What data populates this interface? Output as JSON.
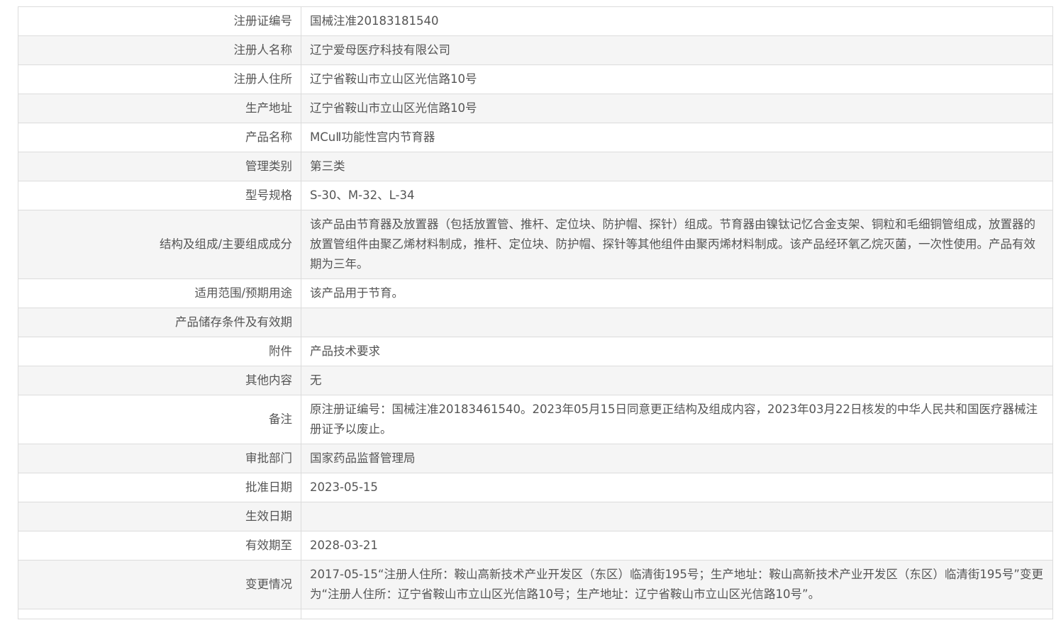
{
  "rows": [
    {
      "label": "注册证编号",
      "value": "国械注准20183181540"
    },
    {
      "label": "注册人名称",
      "value": "辽宁爱母医疗科技有限公司"
    },
    {
      "label": "注册人住所",
      "value": "辽宁省鞍山市立山区光信路10号"
    },
    {
      "label": "生产地址",
      "value": "辽宁省鞍山市立山区光信路10号"
    },
    {
      "label": "产品名称",
      "value": "MCuⅡ功能性宫内节育器"
    },
    {
      "label": "管理类别",
      "value": "第三类"
    },
    {
      "label": "型号规格",
      "value": "S-30、M-32、L-34"
    },
    {
      "label": "结构及组成/主要组成成分",
      "value": "该产品由节育器及放置器（包括放置管、推杆、定位块、防护帽、探针）组成。节育器由镍钛记忆合金支架、铜粒和毛细铜管组成，放置器的放置管组件由聚乙烯材料制成，推杆、定位块、防护帽、探针等其他组件由聚丙烯材料制成。该产品经环氧乙烷灭菌，一次性使用。产品有效期为三年。"
    },
    {
      "label": "适用范围/预期用途",
      "value": "该产品用于节育。"
    },
    {
      "label": "产品储存条件及有效期",
      "value": ""
    },
    {
      "label": "附件",
      "value": "产品技术要求"
    },
    {
      "label": "其他内容",
      "value": "无"
    },
    {
      "label": "备注",
      "value": "原注册证编号：国械注准20183461540。2023年05月15日同意更正结构及组成内容，2023年03月22日核发的中华人民共和国医疗器械注册证予以废止。"
    },
    {
      "label": "审批部门",
      "value": "国家药品监督管理局"
    },
    {
      "label": "批准日期",
      "value": "2023-05-15"
    },
    {
      "label": "生效日期",
      "value": ""
    },
    {
      "label": "有效期至",
      "value": "2028-03-21"
    },
    {
      "label": "变更情况",
      "value": "2017-05-15“注册人住所：鞍山高新技术产业开发区（东区）临清街195号；生产地址：鞍山高新技术产业开发区（东区）临清街195号”变更为“注册人住所：辽宁省鞍山市立山区光信路10号；生产地址：辽宁省鞍山市立山区光信路10号”。"
    }
  ]
}
